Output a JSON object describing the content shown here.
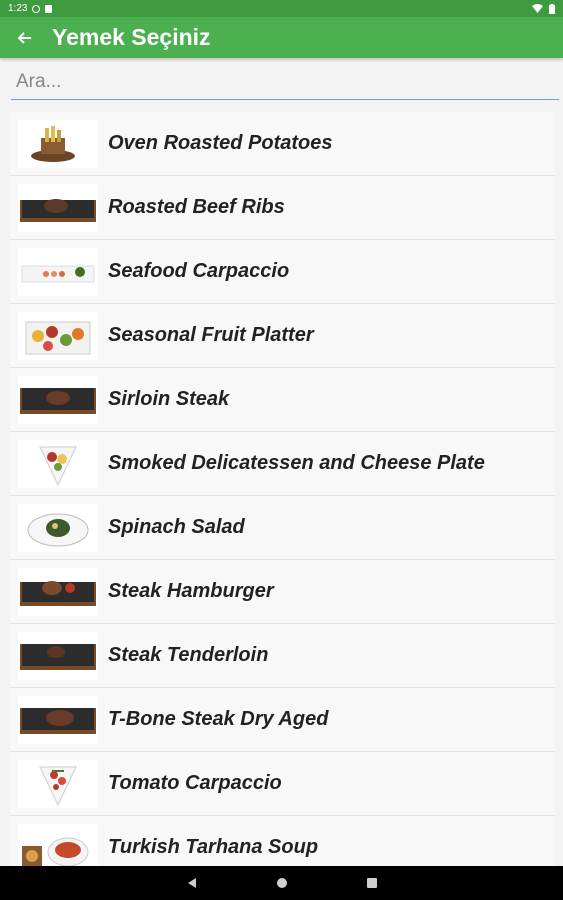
{
  "status_bar": {
    "time": "1:23"
  },
  "app_bar": {
    "title": "Yemek Seçiniz"
  },
  "search": {
    "placeholder": "Ara..."
  },
  "items": [
    {
      "name": "Oven Roasted Potatoes"
    },
    {
      "name": "Roasted Beef Ribs"
    },
    {
      "name": "Seafood Carpaccio"
    },
    {
      "name": "Seasonal Fruit Platter"
    },
    {
      "name": "Sirloin Steak"
    },
    {
      "name": "Smoked Delicatessen and Cheese Plate"
    },
    {
      "name": "Spinach Salad"
    },
    {
      "name": "Steak Hamburger"
    },
    {
      "name": "Steak Tenderloin"
    },
    {
      "name": "T-Bone Steak Dry Aged"
    },
    {
      "name": "Tomato Carpaccio"
    },
    {
      "name": "Turkish Tarhana Soup"
    }
  ],
  "colors": {
    "app_bar": "#4caf50",
    "status_bar": "#3f9b3f",
    "search_underline": "#6aa0d8"
  }
}
